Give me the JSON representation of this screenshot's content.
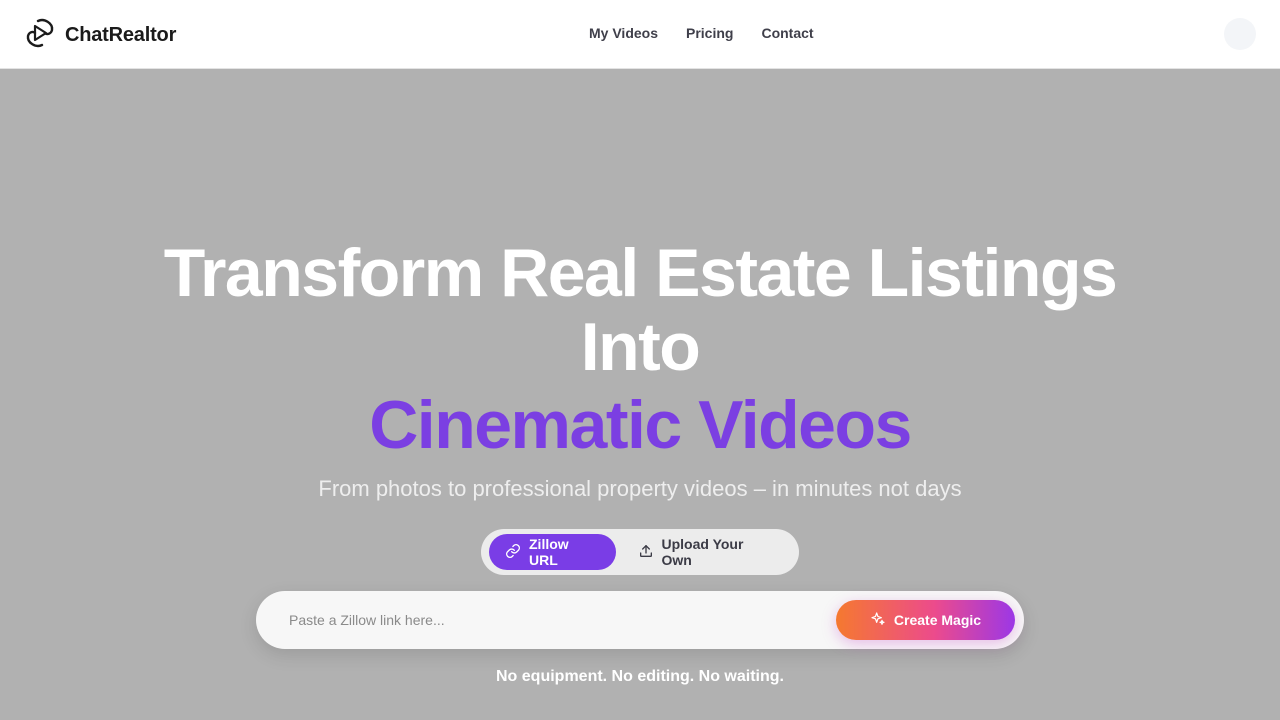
{
  "brand": {
    "name": "ChatRealtor",
    "logo_icon": "play-pin-logo-icon"
  },
  "nav": {
    "items": [
      {
        "label": "My Videos"
      },
      {
        "label": "Pricing"
      },
      {
        "label": "Contact"
      }
    ]
  },
  "hero": {
    "headline_line1": "Transform Real Estate Listings",
    "headline_line2": "Into",
    "headline_accent": "Cinematic Videos",
    "subheadline": "From photos to professional property videos – in minutes not days",
    "accent_color": "#7b3fe2"
  },
  "mode_toggle": {
    "options": [
      {
        "label": "Zillow URL",
        "icon": "link-icon",
        "active": true
      },
      {
        "label": "Upload Your Own",
        "icon": "upload-icon",
        "active": false
      }
    ]
  },
  "search": {
    "placeholder": "Paste a Zillow link here...",
    "value": ""
  },
  "cta": {
    "label": "Create Magic",
    "icon": "sparkle-icon"
  },
  "tagline": "No equipment. No editing. No waiting."
}
